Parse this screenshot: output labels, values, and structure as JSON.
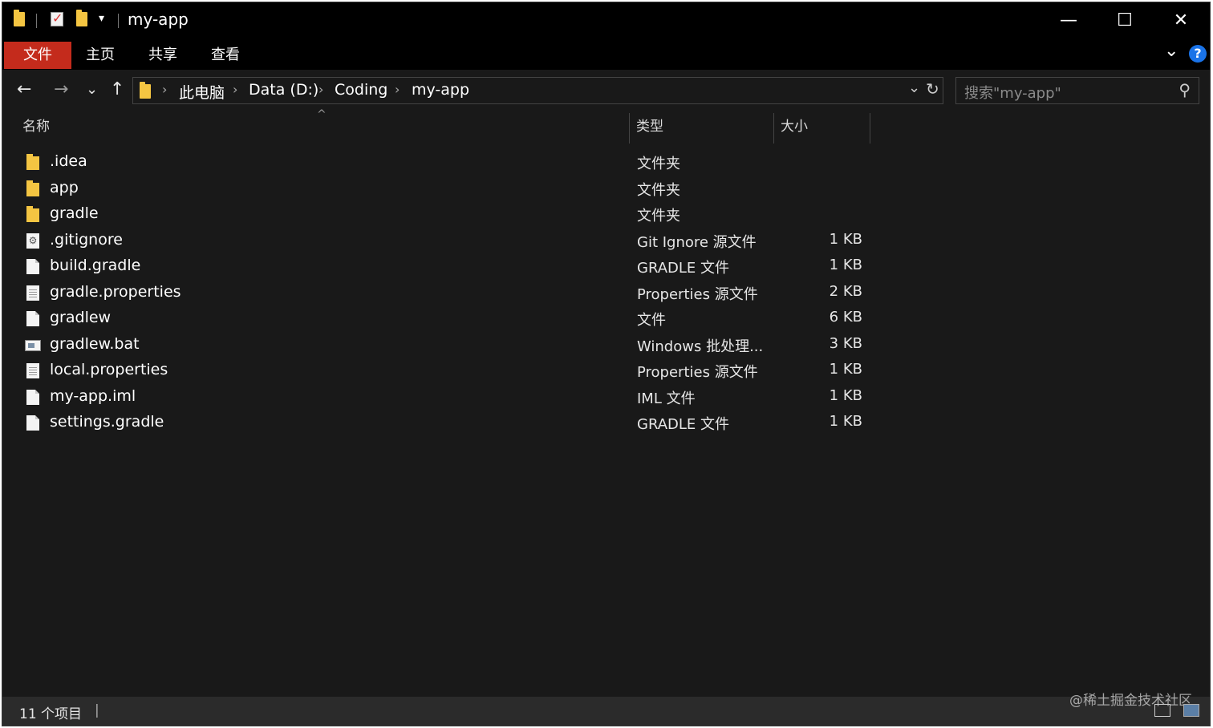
{
  "window": {
    "title": "my-app",
    "qa_dropdown": "▾",
    "controls": {
      "minimize": "—",
      "maximize": "☐",
      "close": "✕"
    }
  },
  "ribbon": {
    "tabs": [
      "文件",
      "主页",
      "共享",
      "查看"
    ],
    "expand": "⌄",
    "help": "?"
  },
  "nav": {
    "back": "←",
    "forward": "→",
    "recent": "⌄",
    "up": "↑",
    "breadcrumb": [
      "此电脑",
      "Data (D:)",
      "Coding",
      "my-app"
    ],
    "refresh": "↻",
    "dropdown": "⌄"
  },
  "search": {
    "placeholder": "搜索\"my-app\"",
    "icon": "⚲"
  },
  "columns": {
    "name": "名称",
    "type": "类型",
    "size": "大小",
    "sort_indicator": "^"
  },
  "files": [
    {
      "name": ".idea",
      "type": "文件夹",
      "size": "",
      "icon": "folder"
    },
    {
      "name": "app",
      "type": "文件夹",
      "size": "",
      "icon": "folder"
    },
    {
      "name": "gradle",
      "type": "文件夹",
      "size": "",
      "icon": "folder"
    },
    {
      "name": ".gitignore",
      "type": "Git Ignore 源文件",
      "size": "1 KB",
      "icon": "gear"
    },
    {
      "name": "build.gradle",
      "type": "GRADLE 文件",
      "size": "1 KB",
      "icon": "doc"
    },
    {
      "name": "gradle.properties",
      "type": "Properties 源文件",
      "size": "2 KB",
      "icon": "lined"
    },
    {
      "name": "gradlew",
      "type": "文件",
      "size": "6 KB",
      "icon": "doc"
    },
    {
      "name": "gradlew.bat",
      "type": "Windows 批处理...",
      "size": "3 KB",
      "icon": "bat"
    },
    {
      "name": "local.properties",
      "type": "Properties 源文件",
      "size": "1 KB",
      "icon": "lined"
    },
    {
      "name": "my-app.iml",
      "type": "IML 文件",
      "size": "1 KB",
      "icon": "doc"
    },
    {
      "name": "settings.gradle",
      "type": "GRADLE 文件",
      "size": "1 KB",
      "icon": "doc"
    }
  ],
  "status": {
    "count": "11 个项目",
    "divider": "|"
  },
  "watermark": "@稀土掘金技术社区",
  "colors": {
    "accent": "#c42b1c",
    "folder": "#f4c542",
    "background": "#191919",
    "help": "#1a73e8"
  }
}
